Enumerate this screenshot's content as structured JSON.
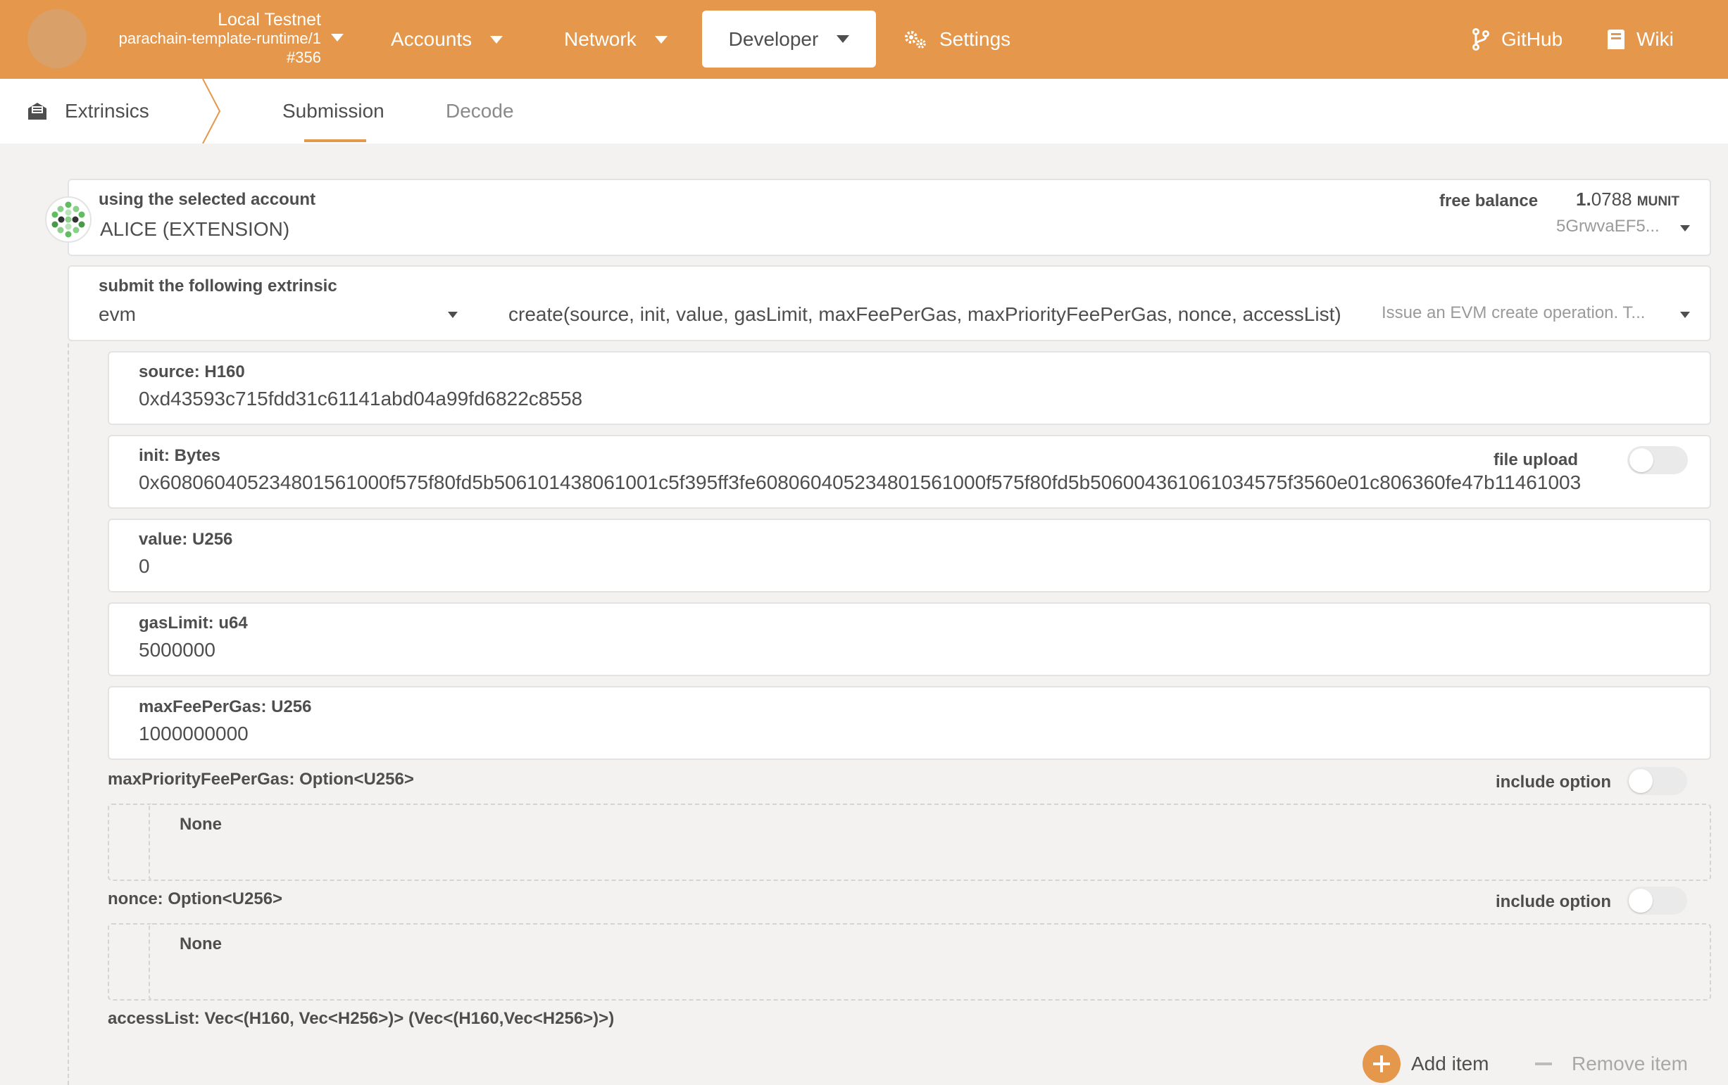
{
  "header": {
    "chain_name": "Local Testnet",
    "runtime": "parachain-template-runtime/1",
    "block": "#356",
    "nav": {
      "accounts": "Accounts",
      "network": "Network",
      "developer": "Developer",
      "settings": "Settings",
      "github": "GitHub",
      "wiki": "Wiki"
    },
    "colors": {
      "bar": "#e5974b",
      "text": "#ffffff"
    }
  },
  "subheader": {
    "section": "Extrinsics",
    "tabs": [
      "Submission",
      "Decode"
    ]
  },
  "account": {
    "label": "using the selected account",
    "name": "ALICE (EXTENSION)",
    "balance_label": "free balance",
    "balance_int": "1.",
    "balance_dec": "0788",
    "balance_unit": "MUNIT",
    "address_short": "5GrwvaEF5..."
  },
  "extrinsic": {
    "label": "submit the following extrinsic",
    "pallet": "evm",
    "call": "create(source, init, value, gasLimit, maxFeePerGas, maxPriorityFeePerGas, nonce, accessList)",
    "description": "Issue an EVM create operation. T..."
  },
  "params": {
    "source": {
      "label": "source: H160",
      "value": "0xd43593c715fdd31c61141abd04a99fd6822c8558"
    },
    "init": {
      "label": "init: Bytes",
      "value": "0x608060405234801561000f575f80fd5b506101438061001c5f395ff3fe608060405234801561000f575f80fd5b506004361061034575f3560e01c806360fe47b11461003",
      "file_upload": "file upload"
    },
    "value": {
      "label": "value: U256",
      "value": "0"
    },
    "gas_limit": {
      "label": "gasLimit: u64",
      "value": "5000000"
    },
    "max_fee": {
      "label": "maxFeePerGas: U256",
      "value": "1000000000"
    },
    "max_priority": {
      "label": "maxPriorityFeePerGas: Option<U256>",
      "include": "include option",
      "none": "None"
    },
    "nonce": {
      "label": "nonce: Option<U256>",
      "include": "include option",
      "none": "None"
    },
    "access_list": {
      "label": "accessList: Vec<(H160, Vec<H256>)> (Vec<(H160,Vec<H256>)>)"
    }
  },
  "actions": {
    "add_item": "Add item",
    "remove_item": "Remove item"
  }
}
